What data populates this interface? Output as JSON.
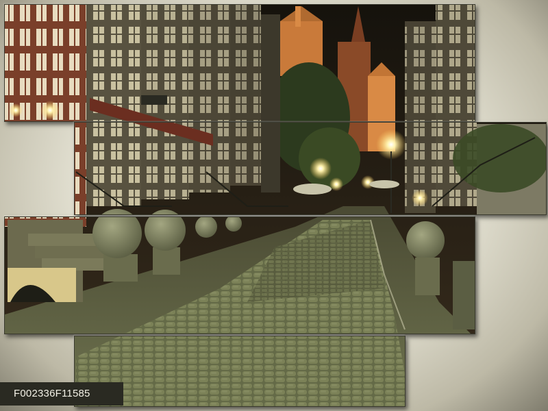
{
  "product": {
    "code": "F002336F11585"
  },
  "colors": {
    "cobblestone": "#5e6443",
    "building_dark": "#4a4536",
    "brick": "#7a3f2a",
    "sky_night": "#1b1710",
    "lamp_glow": "#ffe8a0",
    "church_lit": "#d98a45"
  }
}
